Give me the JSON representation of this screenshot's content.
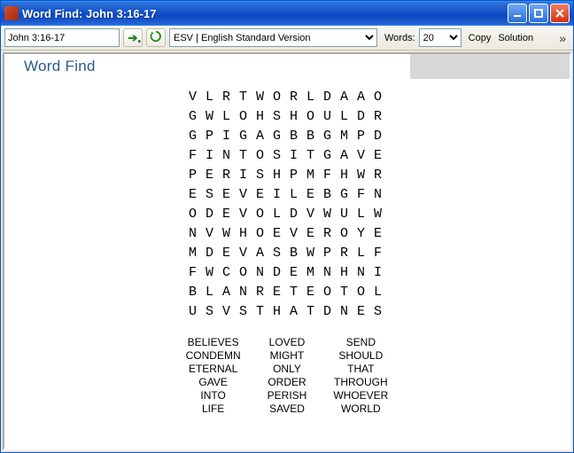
{
  "window": {
    "title": "Word Find: John 3:16-17"
  },
  "toolbar": {
    "reference_value": "John 3:16-17",
    "version_value": "ESV | English Standard Version",
    "words_label": "Words:",
    "words_value": "20",
    "copy_label": "Copy",
    "solution_label": "Solution"
  },
  "page": {
    "heading": "Word Find"
  },
  "grid": [
    "VLRTWORLDAAO",
    "GWLOHSHOULDR",
    "GPIGAGBBGMPD",
    "FINTOSITGAVE",
    "PERISHPMFHWR",
    "ESEVEILEBGFN",
    "ODEVOLDVWULW",
    "NVWHOEVEROYE",
    "MDEVASBWPRLF",
    "FWCONDEMNHNI",
    "BLANRETEOTOL",
    "USVSTHATDNES"
  ],
  "words": {
    "col1": [
      "BELIEVES",
      "CONDEMN",
      "ETERNAL",
      "GAVE",
      "INTO",
      "LIFE"
    ],
    "col2": [
      "LOVED",
      "MIGHT",
      "ONLY",
      "ORDER",
      "PERISH",
      "SAVED"
    ],
    "col3": [
      "SEND",
      "SHOULD",
      "THAT",
      "THROUGH",
      "WHOEVER",
      "WORLD"
    ]
  }
}
